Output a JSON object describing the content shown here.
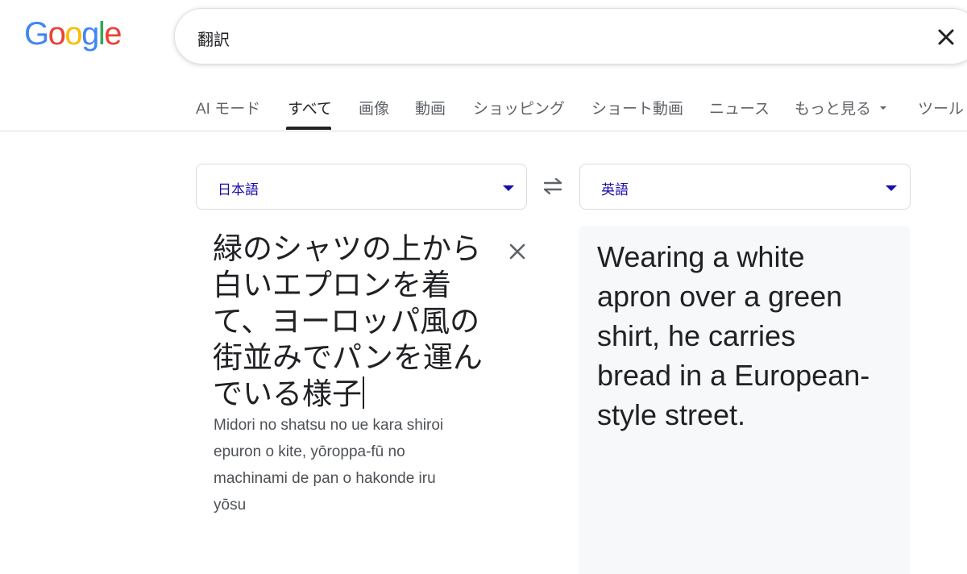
{
  "logo": {
    "text": "Google",
    "colors": [
      "#4285F4",
      "#EA4335",
      "#FBBC05",
      "#4285F4",
      "#34A853",
      "#EA4335"
    ]
  },
  "search": {
    "query": "翻訳",
    "clear_icon": "close-icon"
  },
  "tabs": [
    {
      "label": "AI モード",
      "active": false
    },
    {
      "label": "すべて",
      "active": true
    },
    {
      "label": "画像",
      "active": false
    },
    {
      "label": "動画",
      "active": false
    },
    {
      "label": "ショッピング",
      "active": false
    },
    {
      "label": "ショート動画",
      "active": false
    },
    {
      "label": "ニュース",
      "active": false
    },
    {
      "label": "もっと見る",
      "active": false
    },
    {
      "label": "ツール",
      "active": false
    }
  ],
  "translate": {
    "source_language": "日本語",
    "target_language": "英語",
    "source_lines": [
      "緑のシャツの上から",
      "白いエプロンを着",
      "て、ヨーロッパ風の",
      "街並みでパンを運ん",
      "でいる様子"
    ],
    "romanization_lines": [
      "Midori no shatsu no ue kara shiroi",
      "epuron o kite, yōroppa-fū no",
      "machinami de pan o hakonde iru",
      "yōsu"
    ],
    "target_lines": [
      "Wearing a white",
      "apron over a green",
      "shirt, he carries",
      "bread in a European-",
      "style street."
    ]
  },
  "colors": {
    "link": "#1a0dab",
    "text": "#202124",
    "muted": "#5f6368",
    "panel": "#f7f8fa",
    "border": "#dadce0"
  }
}
